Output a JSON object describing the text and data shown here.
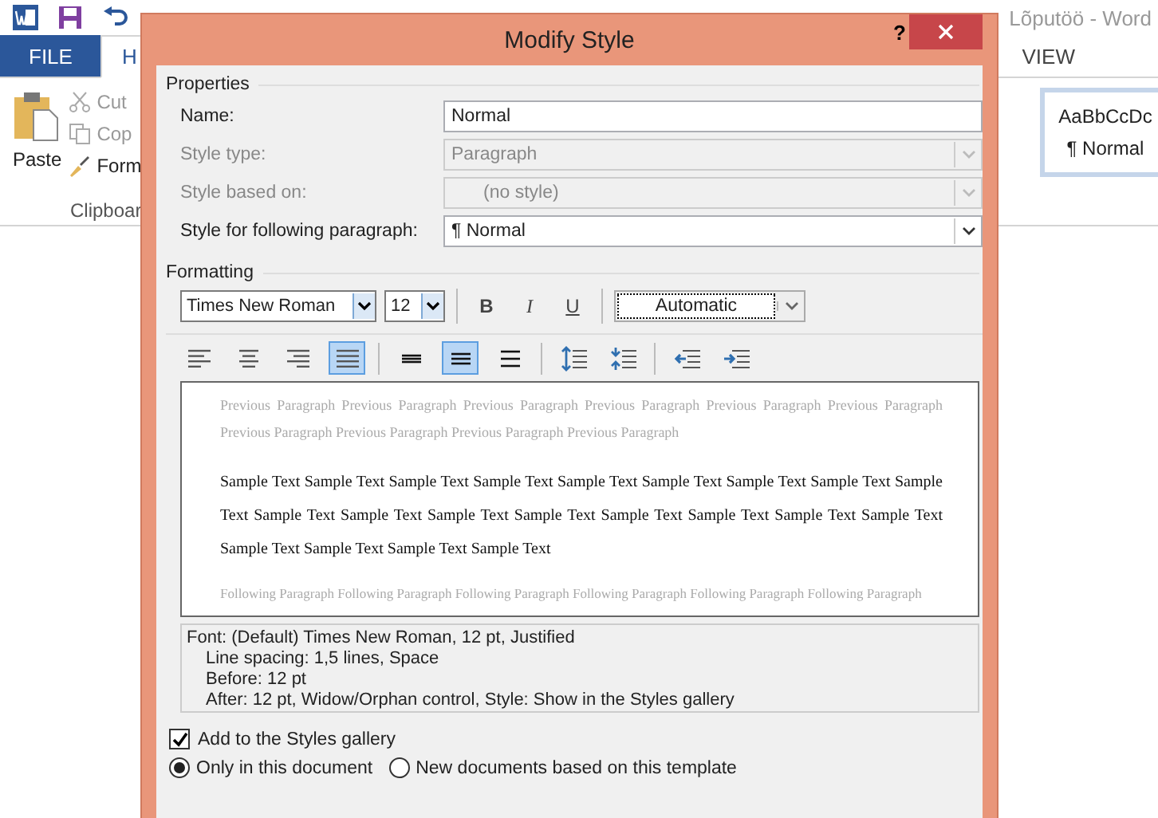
{
  "app": {
    "title": "Lõputöö - Word",
    "tabs": [
      {
        "label": "FILE",
        "selected": false
      },
      {
        "label": "H",
        "selected": true
      },
      {
        "label": "VIEW",
        "selected": false
      }
    ],
    "clipboard": {
      "paste": "Paste",
      "cut": "Cut",
      "copy": "Cop",
      "format": "Form",
      "group": "Clipboar"
    },
    "style_gallery": {
      "preview": "AaBbCcDc",
      "name": "¶ Normal"
    }
  },
  "dialog": {
    "title": "Modify Style",
    "help": "?",
    "properties": {
      "legend": "Properties",
      "fields": [
        {
          "label": "Name:",
          "kind": "text",
          "value": "Normal",
          "disabled": false
        },
        {
          "label": "Style type:",
          "kind": "dropdown",
          "value": "Paragraph",
          "disabled": true
        },
        {
          "label": "Style based on:",
          "kind": "dropdown",
          "value": "(no style)",
          "disabled": true
        },
        {
          "label": "Style for following paragraph:",
          "kind": "dropdown",
          "value": "¶  Normal",
          "disabled": false
        }
      ]
    },
    "formatting": {
      "legend": "Formatting",
      "font": "Times New Roman",
      "size": "12",
      "styles": [
        {
          "label": "B",
          "kind": "bold"
        },
        {
          "label": "I",
          "kind": "italic"
        },
        {
          "label": "U",
          "kind": "underline"
        }
      ],
      "font_color_label": "Automatic",
      "buttons": [
        {
          "kind": "align-left",
          "selected": false
        },
        {
          "kind": "align-center",
          "selected": false
        },
        {
          "kind": "align-right",
          "selected": false
        },
        {
          "kind": "justify",
          "selected": true
        },
        {
          "kind": "sep"
        },
        {
          "kind": "single",
          "selected": false
        },
        {
          "kind": "onehalf",
          "selected": true
        },
        {
          "kind": "double",
          "selected": false
        },
        {
          "kind": "sep"
        },
        {
          "kind": "space-up",
          "selected": false
        },
        {
          "kind": "space-down",
          "selected": false
        },
        {
          "kind": "sep"
        },
        {
          "kind": "outdent",
          "selected": false
        },
        {
          "kind": "indent",
          "selected": false
        }
      ]
    },
    "preview": {
      "previous": "Previous Paragraph Previous Paragraph Previous Paragraph Previous Paragraph Previous Paragraph Previous Paragraph Previous Paragraph Previous Paragraph Previous Paragraph Previous Paragraph",
      "sample": "Sample Text Sample Text Sample Text Sample Text Sample Text Sample Text Sample Text Sample Text Sample Text Sample Text Sample Text Sample Text Sample Text Sample Text Sample Text Sample Text Sample Text Sample Text Sample Text Sample Text Sample Text",
      "following": "Following Paragraph Following Paragraph Following Paragraph Following Paragraph Following Paragraph Following Paragraph"
    },
    "description": [
      "Font: (Default) Times New Roman, 12 pt, Justified",
      "Line spacing:  1,5 lines, Space",
      "Before:  12 pt",
      "After:  12 pt, Widow/Orphan control, Style: Show in the Styles gallery"
    ],
    "add_to_gallery": {
      "label": "Add to the Styles gallery",
      "checked": true
    },
    "scope": [
      {
        "label": "Only in this document",
        "selected": true
      },
      {
        "label": "New documents based on this template",
        "selected": false
      }
    ]
  }
}
